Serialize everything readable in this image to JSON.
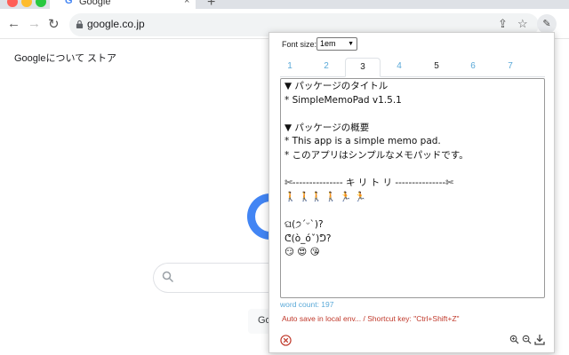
{
  "browser": {
    "tab_title": "Google",
    "tab_favicon": "G",
    "tab_close": "×",
    "new_tab": "+",
    "url": "google.co.jp",
    "back": "←",
    "forward": "→",
    "reload": "↻",
    "share": "⇪",
    "bookmark": "☆",
    "extension_icon": "memo-extension-icon"
  },
  "google": {
    "about_link": "Googleについて",
    "store_link": "ストア",
    "partial_button": "Go",
    "logo_color": "#4285f4"
  },
  "popup": {
    "font_size_label": "Font size:",
    "font_size_value": "1em",
    "tabs": [
      "1",
      "2",
      "3",
      "4",
      "5",
      "6",
      "7"
    ],
    "active_tab": "3",
    "memo_text": "▼ パッケージのタイトル\n* SimpleMemoPad v1.5.1\n\n▼ パッケージの概要\n* This app is a simple memo pad.\n* このアプリはシンプルなメモパッドです。\n\n✄--------------- キ リ ト リ ---------------✄\n🚶 🚶🚶 🚶 🏃 🏃\n\nଘ(੭ˊᵕˋ)?\nᕦ(ò_óˇ)ᕤ?\n😏 😍 😘",
    "word_count": "word count: 197",
    "autosave": "Auto save in local env... / Shortcut key: \"Ctrl+Shift+Z\"",
    "link_color": "#5aa9d8",
    "warn_color": "#c0392b"
  }
}
